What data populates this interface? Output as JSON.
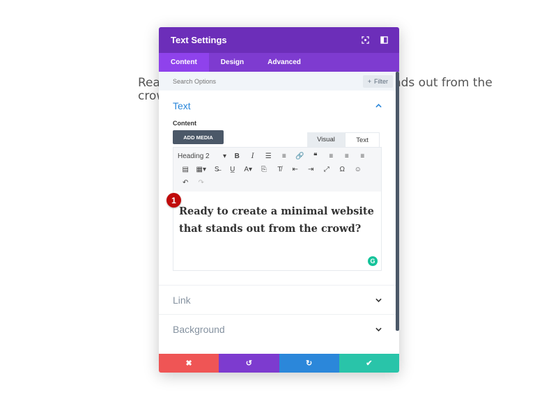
{
  "background": {
    "line1": "Ready to create a minimal website that stands out from the",
    "line2": "crowd?"
  },
  "modal": {
    "title": "Text Settings",
    "header_icons": [
      "fullscreen-icon",
      "sidebar-layout-icon"
    ],
    "tabs": [
      {
        "label": "Content",
        "active": true
      },
      {
        "label": "Design",
        "active": false
      },
      {
        "label": "Advanced",
        "active": false
      }
    ],
    "search": {
      "placeholder": "Search Options"
    },
    "filter_label": "Filter",
    "text_section": {
      "title": "Text",
      "content_label": "Content",
      "add_media": "ADD MEDIA",
      "editor_tabs": {
        "visual": "Visual",
        "text": "Text"
      },
      "format_select": "Heading 2",
      "content": "Ready to create a minimal website that stands out from the crowd?",
      "grammarly": "G"
    },
    "sections": [
      {
        "label": "Link"
      },
      {
        "label": "Background"
      }
    ]
  },
  "marker": {
    "number": "1"
  },
  "colors": {
    "header": "#6c2eb9",
    "tabs": "#7e3bd0",
    "active_tab": "#8f42ec",
    "accent_blue": "#2b87da",
    "cancel": "#ef5555",
    "undo": "#7d3bcf",
    "redo": "#2b87da",
    "save": "#29c4a9"
  }
}
